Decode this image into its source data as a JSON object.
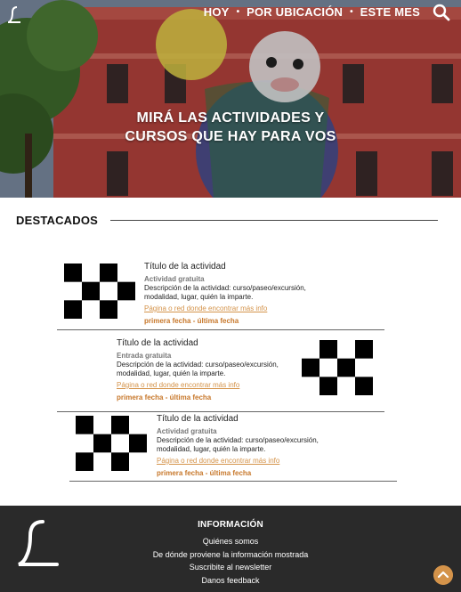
{
  "header": {
    "nav": [
      {
        "label": "HOY"
      },
      {
        "label": "POR UBICACIÓN"
      },
      {
        "label": "ESTE MES"
      }
    ],
    "nav_separator": "•",
    "search_icon": "search-icon",
    "logo_icon": "logo-icon"
  },
  "hero": {
    "title_line1": "MIRÁ LAS ACTIVIDADES Y",
    "title_line2": "CURSOS QUE HAY PARA VOS"
  },
  "featured": {
    "title": "DESTACADOS",
    "cards": [
      {
        "title": "Título de la actividad",
        "price": "Actividad gratuita",
        "desc_line1": "Descripción de la actividad: curso/paseo/excursión,",
        "desc_line2": "modalidad, lugar, quién la imparte.",
        "link": "Página o red donde encontrar más info",
        "dates": "primera fecha - última fecha"
      },
      {
        "title": "Título de la actividad",
        "price": "Entrada gratuita",
        "desc_line1": "Descripción de la actividad: curso/paseo/excursión,",
        "desc_line2": "modalidad, lugar, quién la imparte.",
        "link": "Página o red donde encontrar más info",
        "dates": "primera fecha - última fecha"
      },
      {
        "title": "Título de la actividad",
        "price": "Actividad gratuita",
        "desc_line1": "Descripción de la actividad: curso/paseo/excursión,",
        "desc_line2": "modalidad, lugar, quién la imparte.",
        "link": "Página o red donde encontrar más info",
        "dates": "primera fecha - última fecha"
      }
    ]
  },
  "footer": {
    "heading": "INFORMACIÓN",
    "links": [
      {
        "label": "Quiénes somos"
      },
      {
        "label": "De dónde proviene la información mostrada"
      },
      {
        "label": "Suscribite al newsletter"
      },
      {
        "label": "Danos feedback"
      }
    ],
    "back_to_top_icon": "chevron-up-icon"
  },
  "colors": {
    "accent": "#d4934a",
    "dates": "#c7772a",
    "footer_bg": "#2a2a2a"
  }
}
